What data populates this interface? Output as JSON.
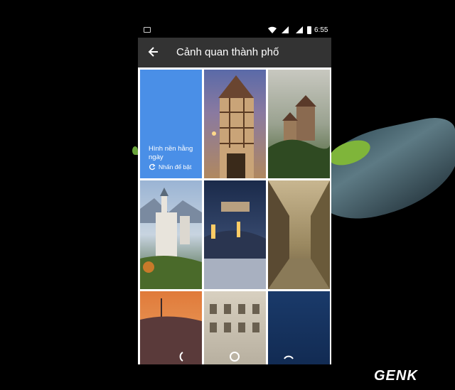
{
  "status_bar": {
    "time": "6:55"
  },
  "app_bar": {
    "title": "Cảnh quan thành phố",
    "back_icon": "arrow-back-icon"
  },
  "daily_tile": {
    "title": "Hình nền hằng ngày",
    "action": "Nhấn để bật",
    "color": "#4a8fe7"
  },
  "watermark": {
    "text": "GENK"
  }
}
